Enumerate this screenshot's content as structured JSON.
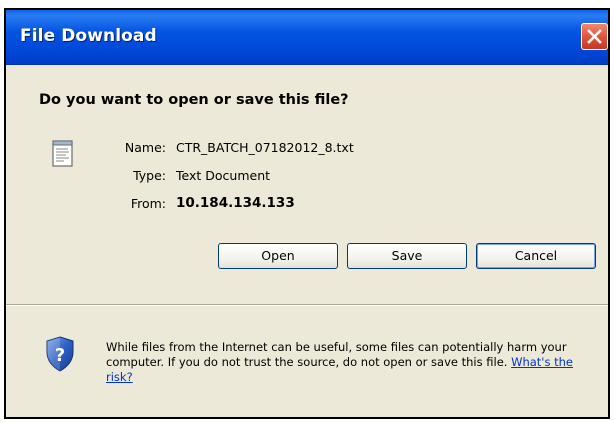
{
  "dialog": {
    "title": "File Download",
    "question": "Do you want to open or save this file?",
    "file": {
      "name_label": "Name:",
      "name_value": "CTR_BATCH_07182012_8.txt",
      "type_label": "Type:",
      "type_value": "Text Document",
      "from_label": "From:",
      "from_value": "10.184.134.133"
    },
    "buttons": {
      "open": "Open",
      "save": "Save",
      "cancel": "Cancel"
    },
    "warning": {
      "text": "While files from the Internet can be useful, some files can potentially harm your computer. If you do not trust the source, do not open or save this file.",
      "link": "What's the risk?"
    }
  },
  "icons": {
    "close": "close-icon",
    "file": "text-file-icon",
    "shield": "security-shield-icon"
  },
  "colors": {
    "titlebar": "#0054e3",
    "dialog_bg": "#ece9d8",
    "close_button": "#e0553a",
    "link": "#0033cc"
  }
}
